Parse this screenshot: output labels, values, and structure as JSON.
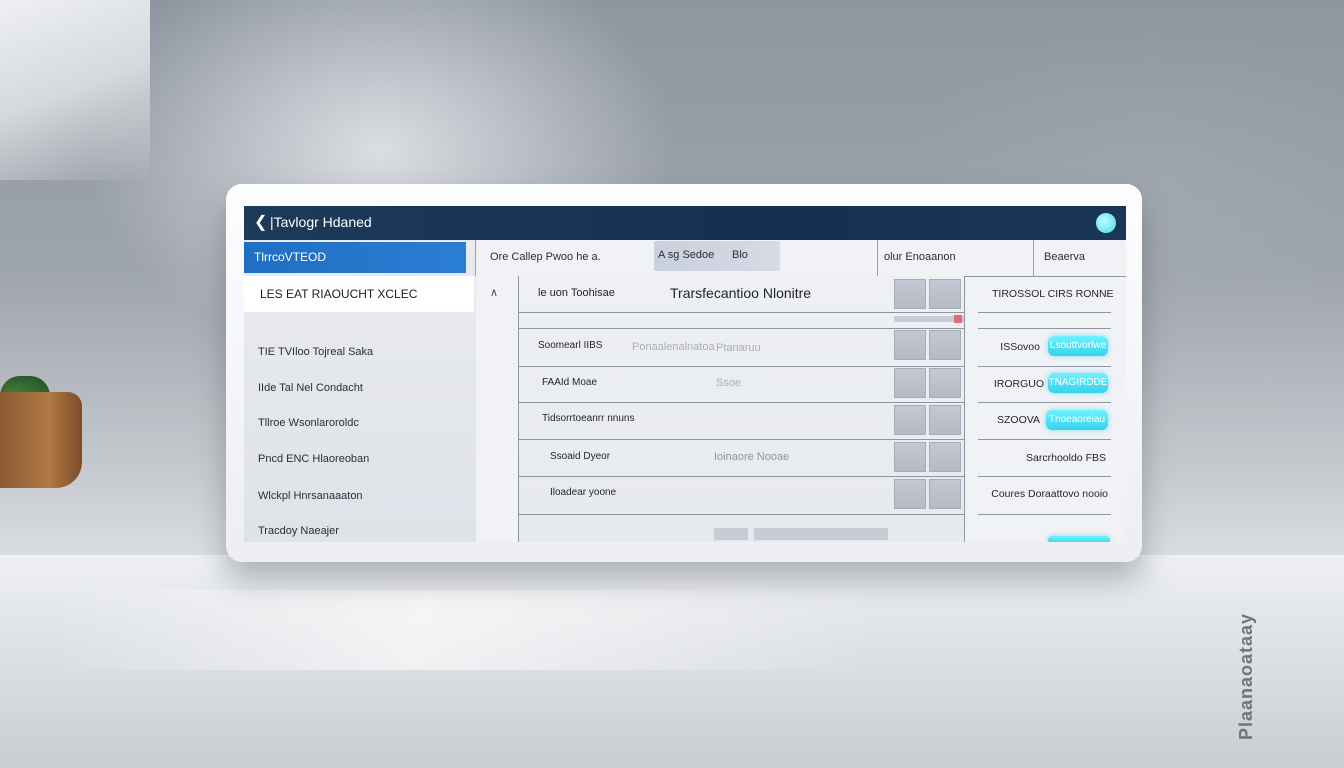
{
  "header": {
    "title": "|Tavlogr Hdaned"
  },
  "sidebar": {
    "active_item": "TlrrcoVTEOD",
    "section_title": "LES EAT RIAOUCHT XCLEC",
    "items": [
      "TIE TVIloo Tojreal Saka",
      "IIde Tal Nel Condacht",
      "Tllroe Wsonlaroroldc",
      "Pncd ENC Hlaoreoban",
      "Wlckpl Hnrsanaaaton",
      "Tracdoy Naeajer"
    ]
  },
  "columns": {
    "col1": "Ore Callep Pwoo he a.",
    "chip_a": "A sg Sedoe",
    "chip_b": "Blo",
    "col3": "olur Enoaanon",
    "col4": "Beaerva"
  },
  "table": {
    "header_left": "le uon Toohisae",
    "header_main": "Trarsfecantioo Nlonitre",
    "header_right": "TIROSSOL CIRS RONNE",
    "rows": [
      {
        "label": "Soomearl IIBS",
        "ghost": "Ponaalenalnatoa",
        "ghost2": "Ptanaruu",
        "right": "ISSovoo",
        "badge": "Lsouttvorlwe"
      },
      {
        "label": "FAAId Moae",
        "ghost": "",
        "ghost2": "Ssoe",
        "right": "IRORGUO",
        "badge": "TNAGIRDDE"
      },
      {
        "label": "Tidsorrtoeanrr nnuns",
        "ghost": "",
        "ghost2": "",
        "right": "SZOOVA",
        "badge": "Tnoeaoreiau"
      },
      {
        "label": "Ssoaid Dyeor",
        "ghost": "Ioinaore Nooae",
        "ghost2": "",
        "right": "Sarcrhooldo FBS",
        "badge": ""
      },
      {
        "label": "Iloadear yoone",
        "ghost": "",
        "ghost2": "",
        "right": "Coures Doraattovo nooio",
        "badge": ""
      }
    ]
  },
  "decor": {
    "side_caption": "Plaanaoataay"
  },
  "colors": {
    "topbar": "#14304f",
    "accent": "#2a7ed3",
    "badge": "#35d3ea"
  }
}
